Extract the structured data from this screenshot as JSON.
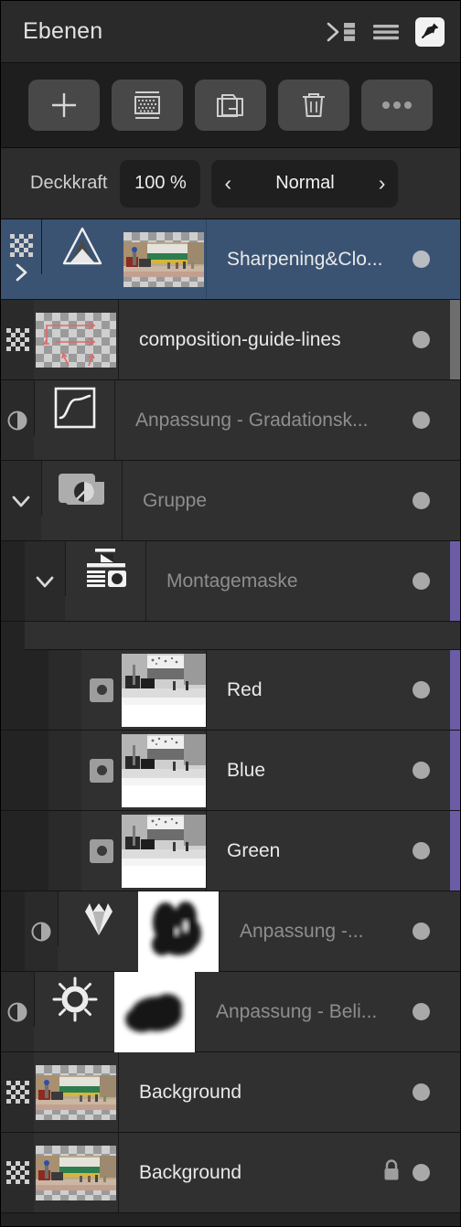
{
  "header": {
    "title": "Ebenen",
    "icons": [
      {
        "name": "collapse-panel-icon"
      },
      {
        "name": "hamburger-menu-icon"
      },
      {
        "name": "pin-icon"
      }
    ]
  },
  "toolbar": {
    "buttons": [
      {
        "name": "add-layer-button",
        "icon": "plus-icon"
      },
      {
        "name": "add-mask-button",
        "icon": "mask-icon"
      },
      {
        "name": "add-group-button",
        "icon": "group-icon"
      },
      {
        "name": "delete-layer-button",
        "icon": "trash-icon"
      },
      {
        "name": "more-options-button",
        "icon": "ellipsis-icon"
      }
    ]
  },
  "opacity": {
    "label": "Deckkraft",
    "value": "100 %",
    "blend_mode": "Normal",
    "prev_arrow": "‹",
    "next_arrow": "›"
  },
  "colors": {
    "selected_row": "#3b5373",
    "accent_purple": "#6b5ca5",
    "panel_bg": "#262626",
    "row_bg": "#303030"
  },
  "layers": [
    {
      "name": "Sharpening&Clo...",
      "selected": true,
      "indent": 0,
      "gutter_icon": "checkerboard-icon",
      "expander": "chevron-right-icon",
      "thumb": "photo-checker",
      "icon": "sharpen-triangle-icon",
      "locked": false,
      "accent": false,
      "scrollbar": false
    },
    {
      "name": "composition-guide-lines",
      "selected": false,
      "indent": 0,
      "gutter_icon": "checkerboard-icon",
      "expander": "",
      "thumb": "guides-checker",
      "icon": "",
      "locked": false,
      "accent": false,
      "scrollbar": true
    },
    {
      "name": "Anpassung - Gradationsk...",
      "selected": false,
      "indent": 0,
      "gutter_icon": "adjustment-circle-icon",
      "expander": "",
      "thumb": "",
      "icon": "curves-icon",
      "locked": false,
      "accent": false,
      "scrollbar": false
    },
    {
      "name": "Gruppe",
      "selected": false,
      "indent": 0,
      "gutter_icon": "",
      "expander": "chevron-down-icon",
      "thumb": "",
      "icon": "group-folder-icon",
      "locked": false,
      "accent": false,
      "scrollbar": false
    },
    {
      "name": "Montagemaske",
      "selected": false,
      "indent": 1,
      "gutter_icon": "",
      "expander": "chevron-down-icon",
      "thumb": "",
      "icon": "channel-mixer-icon",
      "locked": false,
      "accent": true,
      "scrollbar": false
    },
    {
      "name": "Red",
      "selected": false,
      "indent": 2,
      "gutter_icon": "",
      "expander": "",
      "thumb": "gray-photo",
      "icon": "mask-toggle-icon",
      "locked": false,
      "accent": true,
      "scrollbar": false
    },
    {
      "name": "Blue",
      "selected": false,
      "indent": 2,
      "gutter_icon": "",
      "expander": "",
      "thumb": "gray-photo",
      "icon": "mask-toggle-icon",
      "locked": false,
      "accent": true,
      "scrollbar": false
    },
    {
      "name": "Green",
      "selected": false,
      "indent": 2,
      "gutter_icon": "",
      "expander": "",
      "thumb": "gray-photo",
      "icon": "mask-toggle-icon",
      "locked": false,
      "accent": true,
      "scrollbar": false
    },
    {
      "name": "Anpassung -...",
      "selected": false,
      "indent": 1,
      "gutter_icon": "adjustment-circle-icon",
      "expander": "",
      "thumb": "brush-mask",
      "icon": "vibrance-diamond-icon",
      "locked": false,
      "accent": false,
      "scrollbar": false
    },
    {
      "name": "Anpassung - Beli...",
      "selected": false,
      "indent": 0,
      "gutter_icon": "adjustment-circle-icon",
      "expander": "",
      "thumb": "brush-mask",
      "icon": "brightness-sun-icon",
      "locked": false,
      "accent": false,
      "scrollbar": false
    },
    {
      "name": "Background",
      "selected": false,
      "indent": 0,
      "gutter_icon": "checkerboard-icon",
      "expander": "",
      "thumb": "photo-checker",
      "icon": "",
      "locked": false,
      "accent": false,
      "scrollbar": false
    },
    {
      "name": "Background",
      "selected": false,
      "indent": 0,
      "gutter_icon": "checkerboard-icon",
      "expander": "",
      "thumb": "photo-checker",
      "icon": "",
      "locked": true,
      "accent": false,
      "scrollbar": false
    }
  ]
}
